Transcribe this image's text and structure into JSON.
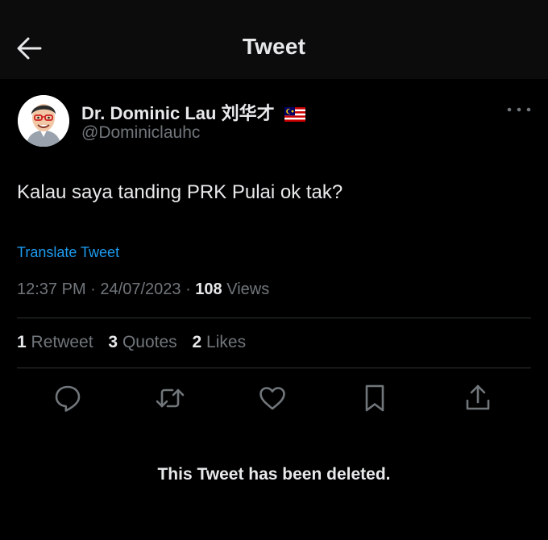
{
  "header": {
    "title": "Tweet"
  },
  "author": {
    "display_name": "Dr. Dominic Lau 刘华才",
    "handle": "@Dominiclauhc",
    "flag_icon": "malaysia-flag-icon"
  },
  "tweet": {
    "text": "Kalau saya tanding PRK Pulai ok tak?",
    "translate_label": "Translate Tweet",
    "time": "12:37 PM",
    "date": "24/07/2023",
    "views_count": "108",
    "views_label": "Views"
  },
  "stats": {
    "retweets_count": "1",
    "retweets_label": "Retweet",
    "quotes_count": "3",
    "quotes_label": "Quotes",
    "likes_count": "2",
    "likes_label": "Likes"
  },
  "actions": [
    "reply-icon",
    "retweet-icon",
    "like-icon",
    "bookmark-icon",
    "share-icon"
  ],
  "deleted_notice": "This Tweet has been deleted.",
  "colors": {
    "background": "#000000",
    "header_background": "#0c0c0c",
    "text": "#e7e9ea",
    "muted": "#71767b",
    "link": "#1d9bf0",
    "divider": "#2f3336"
  }
}
